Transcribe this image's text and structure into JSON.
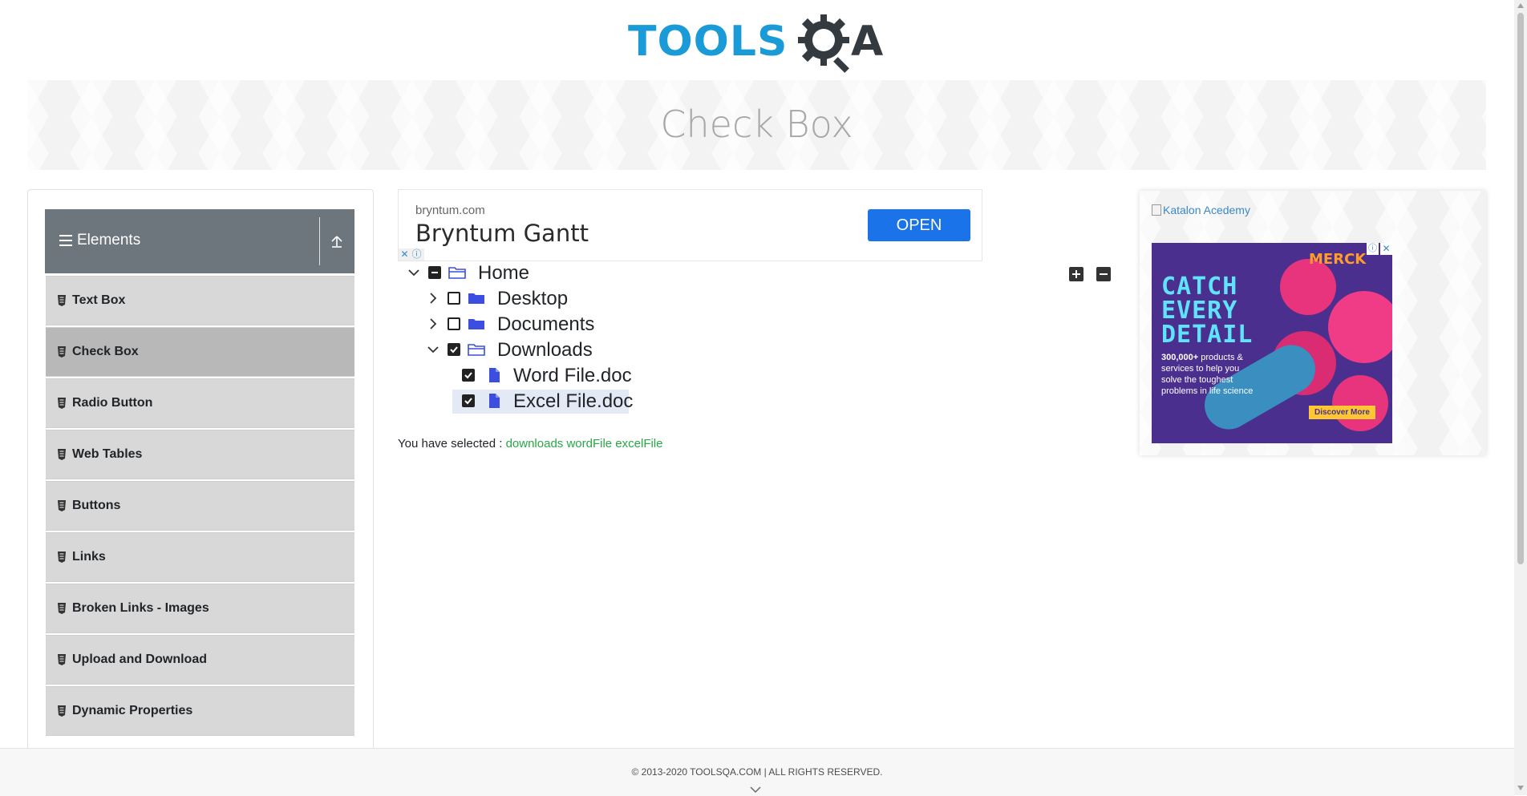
{
  "logo": {
    "text_part": "TOOLS",
    "q_part": "QA"
  },
  "banner": {
    "title": "Check Box"
  },
  "sidebar": {
    "group_title": "Elements",
    "items": [
      {
        "label": "Text Box",
        "active": false
      },
      {
        "label": "Check Box",
        "active": true
      },
      {
        "label": "Radio Button",
        "active": false
      },
      {
        "label": "Web Tables",
        "active": false
      },
      {
        "label": "Buttons",
        "active": false
      },
      {
        "label": "Links",
        "active": false
      },
      {
        "label": "Broken Links - Images",
        "active": false
      },
      {
        "label": "Upload and Download",
        "active": false
      },
      {
        "label": "Dynamic Properties",
        "active": false
      }
    ]
  },
  "ad_top": {
    "domain": "bryntum.com",
    "title": "Bryntum Gantt",
    "button_label": "OPEN",
    "choices_close": "✕",
    "choices_info": "ⓘ"
  },
  "tree": {
    "nodes": [
      {
        "label": "Home",
        "expanded": true,
        "state": "half",
        "type": "folder-open"
      },
      {
        "label": "Desktop",
        "expanded": false,
        "state": "unchecked",
        "type": "folder"
      },
      {
        "label": "Documents",
        "expanded": false,
        "state": "unchecked",
        "type": "folder"
      },
      {
        "label": "Downloads",
        "expanded": true,
        "state": "checked",
        "type": "folder-open"
      },
      {
        "label": "Word File.doc",
        "state": "checked",
        "type": "file"
      },
      {
        "label": "Excel File.doc",
        "state": "checked",
        "type": "file",
        "highlighted": true
      }
    ]
  },
  "result": {
    "prefix": "You have selected :",
    "selected": "downloads wordFile excelFile"
  },
  "right_ad": {
    "broken_image_alt": "Katalon Acedemy",
    "brand": "MERCK",
    "headline": "CATCH EVERY DETAIL",
    "body_bold": "300,000+",
    "body_text": "products & services to help you solve the toughest problems in life science",
    "cta": "Discover More"
  },
  "footer": {
    "copyright": "© 2013-2020 TOOLSQA.COM | ALL RIGHTS RESERVED."
  },
  "colors": {
    "brand_blue": "#1a9bd7",
    "sidebar_header": "#6d757d",
    "menu_item": "#d8d8d8",
    "menu_item_active": "#b8b8b8",
    "result_green": "#28a745",
    "open_button": "#1a73e8"
  },
  "icons": {
    "menu": "hamburger-icon",
    "collapse": "upload-arrow-icon",
    "menu_item": "html5-shield-icon",
    "expand_all": "plus-square-icon",
    "collapse_all": "minus-square-icon"
  }
}
